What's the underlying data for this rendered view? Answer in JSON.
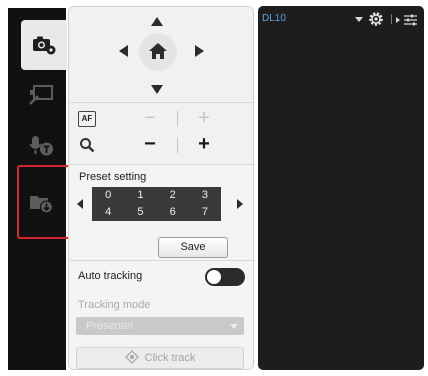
{
  "rail": {
    "items": [
      {
        "name": "camera-settings",
        "icon": "camera-gear-icon",
        "active": true
      },
      {
        "name": "annotation",
        "icon": "board-pen-icon",
        "active": false
      },
      {
        "name": "audio",
        "icon": "microphone-t-icon",
        "active": false
      },
      {
        "name": "recording",
        "icon": "folder-download-icon",
        "active": false,
        "highlighted": true
      }
    ],
    "highlight_color": "#d8242c"
  },
  "ptz": {
    "up_icon": "arrow-up-icon",
    "down_icon": "arrow-down-icon",
    "left_icon": "arrow-left-icon",
    "right_icon": "arrow-right-icon",
    "home_icon": "home-icon"
  },
  "zoom": {
    "autofocus_label": "AF",
    "focus_icon": "autofocus-icon",
    "zoom_icon": "magnifier-icon",
    "minus": "−",
    "plus": "+"
  },
  "preset": {
    "title": "Preset setting",
    "cells": [
      "0",
      "1",
      "2",
      "3",
      "4",
      "5",
      "6",
      "7"
    ],
    "save_label": "Save"
  },
  "tracking": {
    "auto_label": "Auto tracking",
    "auto_enabled": false,
    "mode_label": "Tracking mode",
    "mode_value": "Presenter",
    "click_track_label": "Click track",
    "click_track_icon": "crosshair-icon"
  },
  "preview": {
    "device_name": "DL10",
    "device_name_color": "#5aa5e0",
    "background": "#1d1d1d",
    "settings_icon": "gear-icon",
    "toggle_icon": "sliders-icon"
  }
}
